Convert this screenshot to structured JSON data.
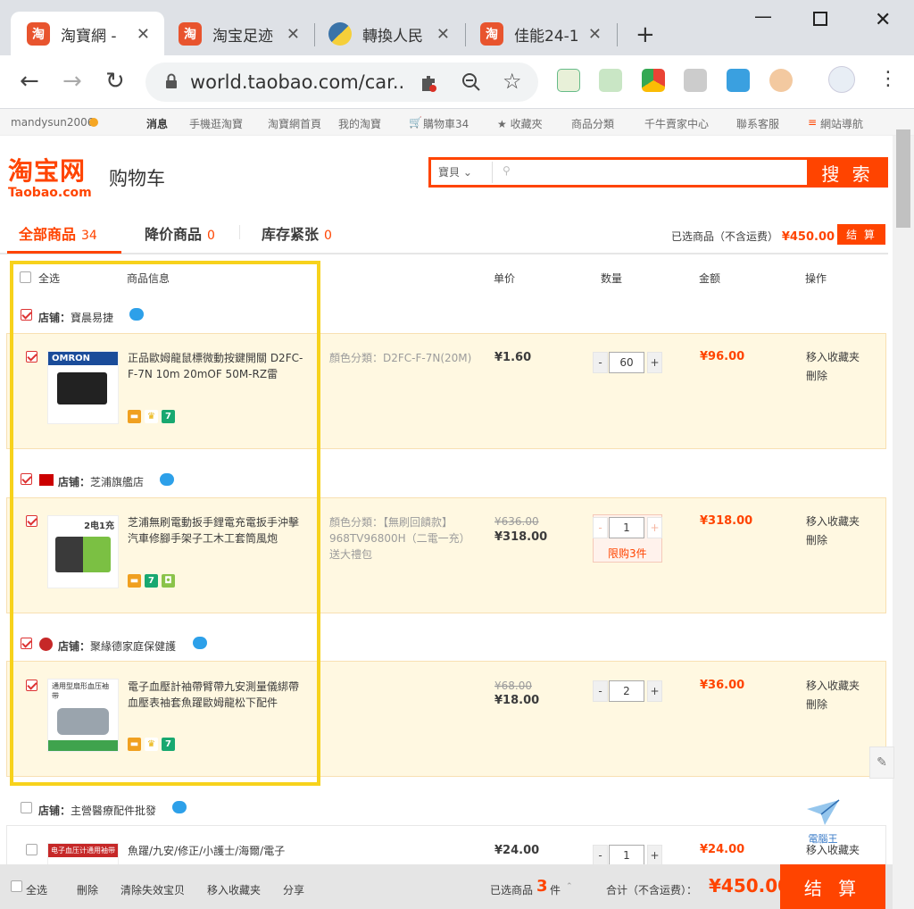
{
  "browser": {
    "tabs": [
      {
        "label": "淘寶網 -",
        "icon": "taobao-icon"
      },
      {
        "label": "淘宝足迹",
        "icon": "taobao-icon"
      },
      {
        "label": "轉換人民",
        "icon": "python-icon"
      },
      {
        "label": "佳能24-1",
        "icon": "taobao-icon"
      }
    ],
    "url": "world.taobao.com/car..."
  },
  "site_nav": {
    "user": "mandysun2006",
    "items": [
      "消息",
      "手機逛淘寶",
      "淘寶網首頁",
      "我的淘寶",
      "購物車34",
      "收藏夾",
      "商品分類",
      "千牛賣家中心",
      "聯系客服",
      "網站導航"
    ]
  },
  "header": {
    "logo_cn": "淘宝网",
    "logo_en": "Taobao.com",
    "title": "购物车",
    "search_scope": "寶貝",
    "search_button": "搜 索"
  },
  "cart_tabs": [
    {
      "label": "全部商品",
      "count": "34"
    },
    {
      "label": "降价商品",
      "count": "0"
    },
    {
      "label": "库存紧张",
      "count": "0"
    }
  ],
  "summary_top": {
    "label": "已选商品（不含运费）",
    "amount": "¥450.00",
    "button": "结 算"
  },
  "columns": {
    "select_all": "全选",
    "info": "商品信息",
    "unit": "单价",
    "qty": "数量",
    "amount": "金额",
    "op": "操作"
  },
  "shops": [
    {
      "name": "寶晨易捷",
      "prefix": "店铺：",
      "items": [
        {
          "name": "正品歐姆龍鼠標微動按鍵開關 D2FC-F-7N 10m 20mOF 50M-RZ雷",
          "sku": "顏色分類：D2FC-F-7N(20M)",
          "orig": "",
          "price": "¥1.60",
          "qty": "60",
          "amount": "¥96.00",
          "thumb_text": "OMRON"
        }
      ]
    },
    {
      "name": "芝浦旗艦店",
      "prefix": "店铺：",
      "items": [
        {
          "name": "芝浦無刷電動扳手鋰電充電扳手沖擊汽車修腳手架子工木工套筒風炮",
          "sku": "顏色分類：【無刷回饋款】968TV96800H（二電一充）送大禮包",
          "orig": "¥636.00",
          "price": "¥318.00",
          "qty": "1",
          "limit": "限购3件",
          "amount": "¥318.00",
          "thumb_text": "2电1充"
        }
      ]
    },
    {
      "name": "聚緣德家庭保健護",
      "prefix": "店铺：",
      "items": [
        {
          "name": "電子血壓計袖帶臂帶九安測量儀綁帶血壓表袖套魚躍歐姆龍松下配件",
          "sku": "",
          "orig": "¥68.00",
          "price": "¥18.00",
          "qty": "2",
          "amount": "¥36.00",
          "thumb_text": "通用型扇形血压袖带"
        }
      ]
    },
    {
      "name": "主營醫療配件批發",
      "prefix": "店铺：",
      "items": [
        {
          "name": "魚躍/九安/修正/小護士/海爾/電子",
          "sku": "",
          "orig": "",
          "price": "¥24.00",
          "qty": "1",
          "amount": "¥24.00",
          "thumb_text": "电子血压计通用袖带"
        }
      ]
    }
  ],
  "item_ops": [
    "移入收藏夹",
    "刪除"
  ],
  "bottom": {
    "select_all": "全选",
    "delete": "刪除",
    "clear": "清除失效宝贝",
    "move": "移入收藏夹",
    "share": "分享",
    "selected_label": "已选商品",
    "selected_count": "3",
    "selected_unit": "件",
    "total_label": "合计（不含运费）：",
    "total": "¥450.00",
    "checkout": "结 算"
  },
  "watermark": "電腦王"
}
